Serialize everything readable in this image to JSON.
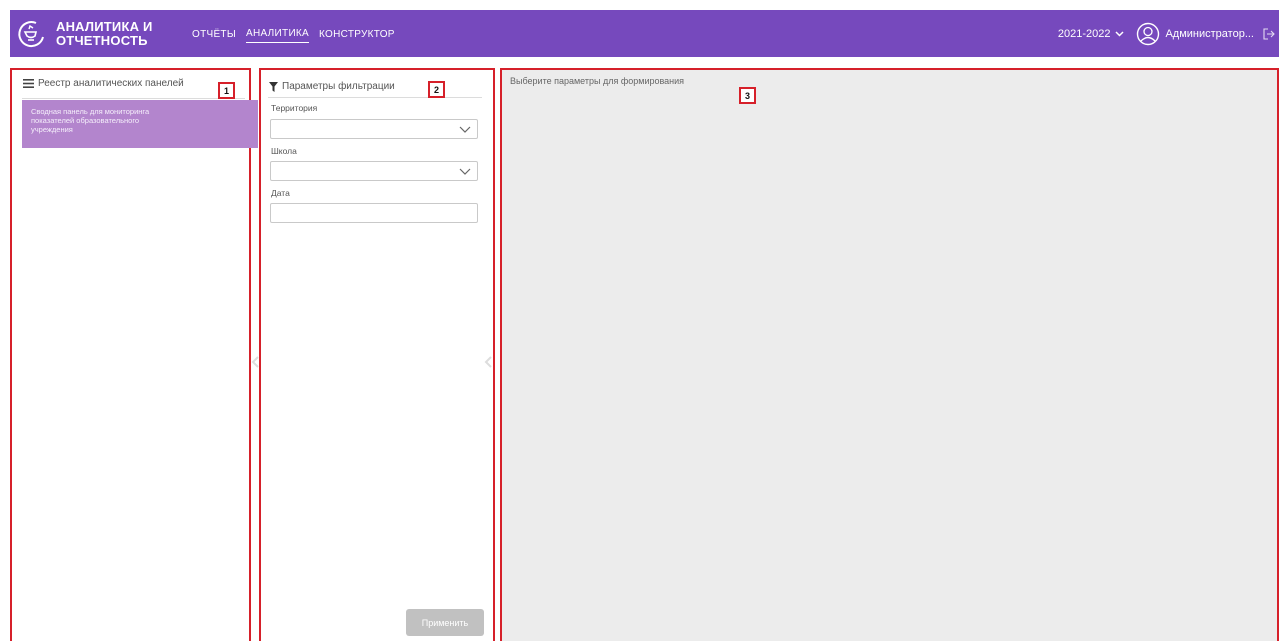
{
  "header": {
    "logo_line1": "АНАЛИТИКА И",
    "logo_line2": "ОТЧЕТНОСТЬ",
    "nav": [
      {
        "label": "ОТЧЁТЫ",
        "active": false
      },
      {
        "label": "АНАЛИТИКА",
        "active": true
      },
      {
        "label": "КОНСТРУКТОР",
        "active": false
      }
    ],
    "year": "2021-2022",
    "user": "Администратор..."
  },
  "panel1": {
    "title": "Реестр аналитических панелей",
    "item_line1": "Сводная панель для мониторинга",
    "item_line2": "показателей образовательного",
    "item_line3": "учреждения",
    "badge": "1"
  },
  "panel2": {
    "title": "Параметры фильтрации",
    "territory_label": "Территория",
    "school_label": "Школа",
    "date_label": "Дата",
    "apply_label": "Применить",
    "badge": "2"
  },
  "panel3": {
    "message": "Выберите параметры для формирования",
    "badge": "3"
  },
  "colors": {
    "header_bg": "#7649bd",
    "active_item_bg": "#b385cd",
    "annotation_red": "#d6202a",
    "content_bg": "#ececec"
  },
  "icons": [
    "logo-icon",
    "chevron-down-icon",
    "user-avatar-icon",
    "logout-icon",
    "menu-icon",
    "filter-icon",
    "collapse-handle-icon"
  ]
}
